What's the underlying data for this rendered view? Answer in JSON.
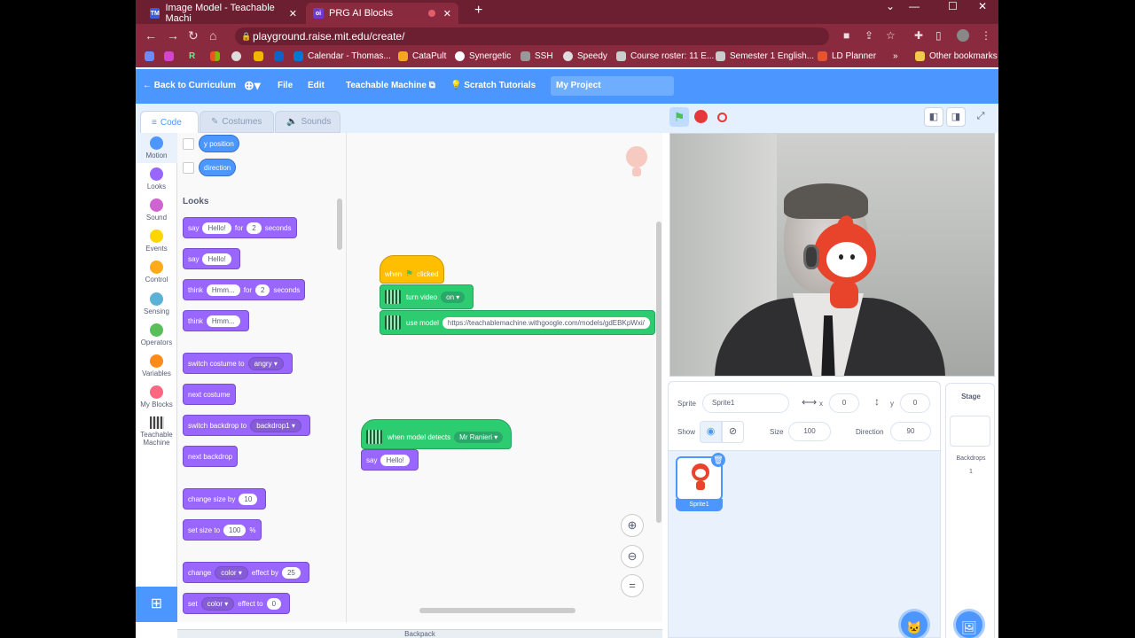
{
  "browser": {
    "tabs": [
      {
        "title": "Image Model - Teachable Machi",
        "favicon": "TM"
      },
      {
        "title": "PRG AI Blocks",
        "favicon": "oi"
      }
    ],
    "url": "playground.raise.mit.edu/create/",
    "bookmarks": [
      "R",
      "Calendar - Thomas...",
      "CataPult",
      "Synergetic",
      "SSH",
      "Speedy",
      "Course roster: 11 E...",
      "Semester 1 English...",
      "LD Planner",
      "Other bookmarks"
    ]
  },
  "menubar": {
    "back": "← Back to Curriculum",
    "file": "File",
    "edit": "Edit",
    "teachable": "Teachable Machine",
    "tutorials": "Scratch Tutorials",
    "project_title": "My Project"
  },
  "editor_tabs": {
    "code": "Code",
    "costumes": "Costumes",
    "sounds": "Sounds"
  },
  "categories": [
    {
      "label": "Motion",
      "color": "#4c97ff"
    },
    {
      "label": "Looks",
      "color": "#9966ff"
    },
    {
      "label": "Sound",
      "color": "#cf63cf"
    },
    {
      "label": "Events",
      "color": "#ffd500"
    },
    {
      "label": "Control",
      "color": "#ffab19"
    },
    {
      "label": "Sensing",
      "color": "#5cb1d6"
    },
    {
      "label": "Operators",
      "color": "#59c059"
    },
    {
      "label": "Variables",
      "color": "#ff8c1a"
    },
    {
      "label": "My Blocks",
      "color": "#ff6680"
    },
    {
      "label": "Teachable Machine",
      "color": "#2ecc71"
    }
  ],
  "palette": {
    "y_position": "y position",
    "direction": "direction",
    "heading": "Looks",
    "say": "say",
    "for": "for",
    "seconds": "seconds",
    "hello": "Hello!",
    "two": "2",
    "think": "think",
    "hmm": "Hmm...",
    "switch_costume": "switch costume to",
    "angry": "angry",
    "next_costume": "next costume",
    "switch_backdrop": "switch backdrop to",
    "backdrop1": "backdrop1",
    "next_backdrop": "next backdrop",
    "change_size": "change size by",
    "ten": "10",
    "set_size": "set size to",
    "hundred": "100",
    "percent": "%",
    "change": "change",
    "color": "color",
    "effect_by": "effect by",
    "twentyfive": "25",
    "set": "set",
    "effect_to": "effect to",
    "zero": "0"
  },
  "script": {
    "when_clicked_a": "when",
    "when_clicked_b": "clicked",
    "turn_video": "turn video",
    "on": "on",
    "use_model": "use model",
    "model_url": "https://teachablemachine.withgoogle.com/models/gdEBKpWxi/",
    "when_detects": "when model detects",
    "detect_label": "Mr Ranieri",
    "say": "say",
    "hello": "Hello!"
  },
  "backpack": "Backpack",
  "sprite_info": {
    "sprite_label": "Sprite",
    "sprite_name": "Sprite1",
    "x_label": "x",
    "x": "0",
    "y_label": "y",
    "y": "0",
    "show_label": "Show",
    "size_label": "Size",
    "size": "100",
    "direction_label": "Direction",
    "direction": "90",
    "thumb_name": "Sprite1"
  },
  "stage_pane": {
    "title": "Stage",
    "backdrops_label": "Backdrops",
    "backdrops_count": "1"
  }
}
